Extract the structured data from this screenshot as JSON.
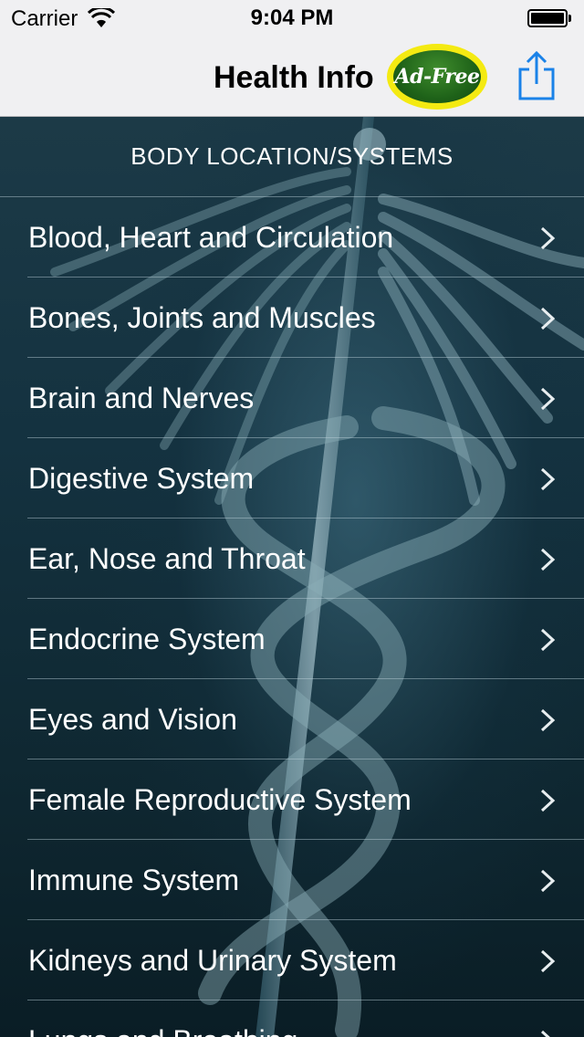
{
  "status_bar": {
    "carrier": "Carrier",
    "time": "9:04 PM",
    "wifi_icon": "wifi-icon",
    "battery_icon": "battery-icon"
  },
  "nav": {
    "title": "Health Info",
    "adfree_badge": "Ad-Free",
    "share_icon": "share-icon"
  },
  "section": {
    "header": "BODY LOCATION/SYSTEMS"
  },
  "items": [
    {
      "label": "Blood, Heart and Circulation"
    },
    {
      "label": "Bones, Joints and Muscles"
    },
    {
      "label": "Brain and Nerves"
    },
    {
      "label": "Digestive System"
    },
    {
      "label": "Ear, Nose and Throat"
    },
    {
      "label": "Endocrine System"
    },
    {
      "label": "Eyes and Vision"
    },
    {
      "label": "Female Reproductive System"
    },
    {
      "label": "Immune System"
    },
    {
      "label": "Kidneys and Urinary System"
    },
    {
      "label": "Lungs and Breathing"
    }
  ],
  "colors": {
    "nav_background": "#f0f0f2",
    "accent_blue": "#1a82e8",
    "badge_yellow": "#f4ea12",
    "badge_green": "#1f6319",
    "list_background": "#143240"
  }
}
